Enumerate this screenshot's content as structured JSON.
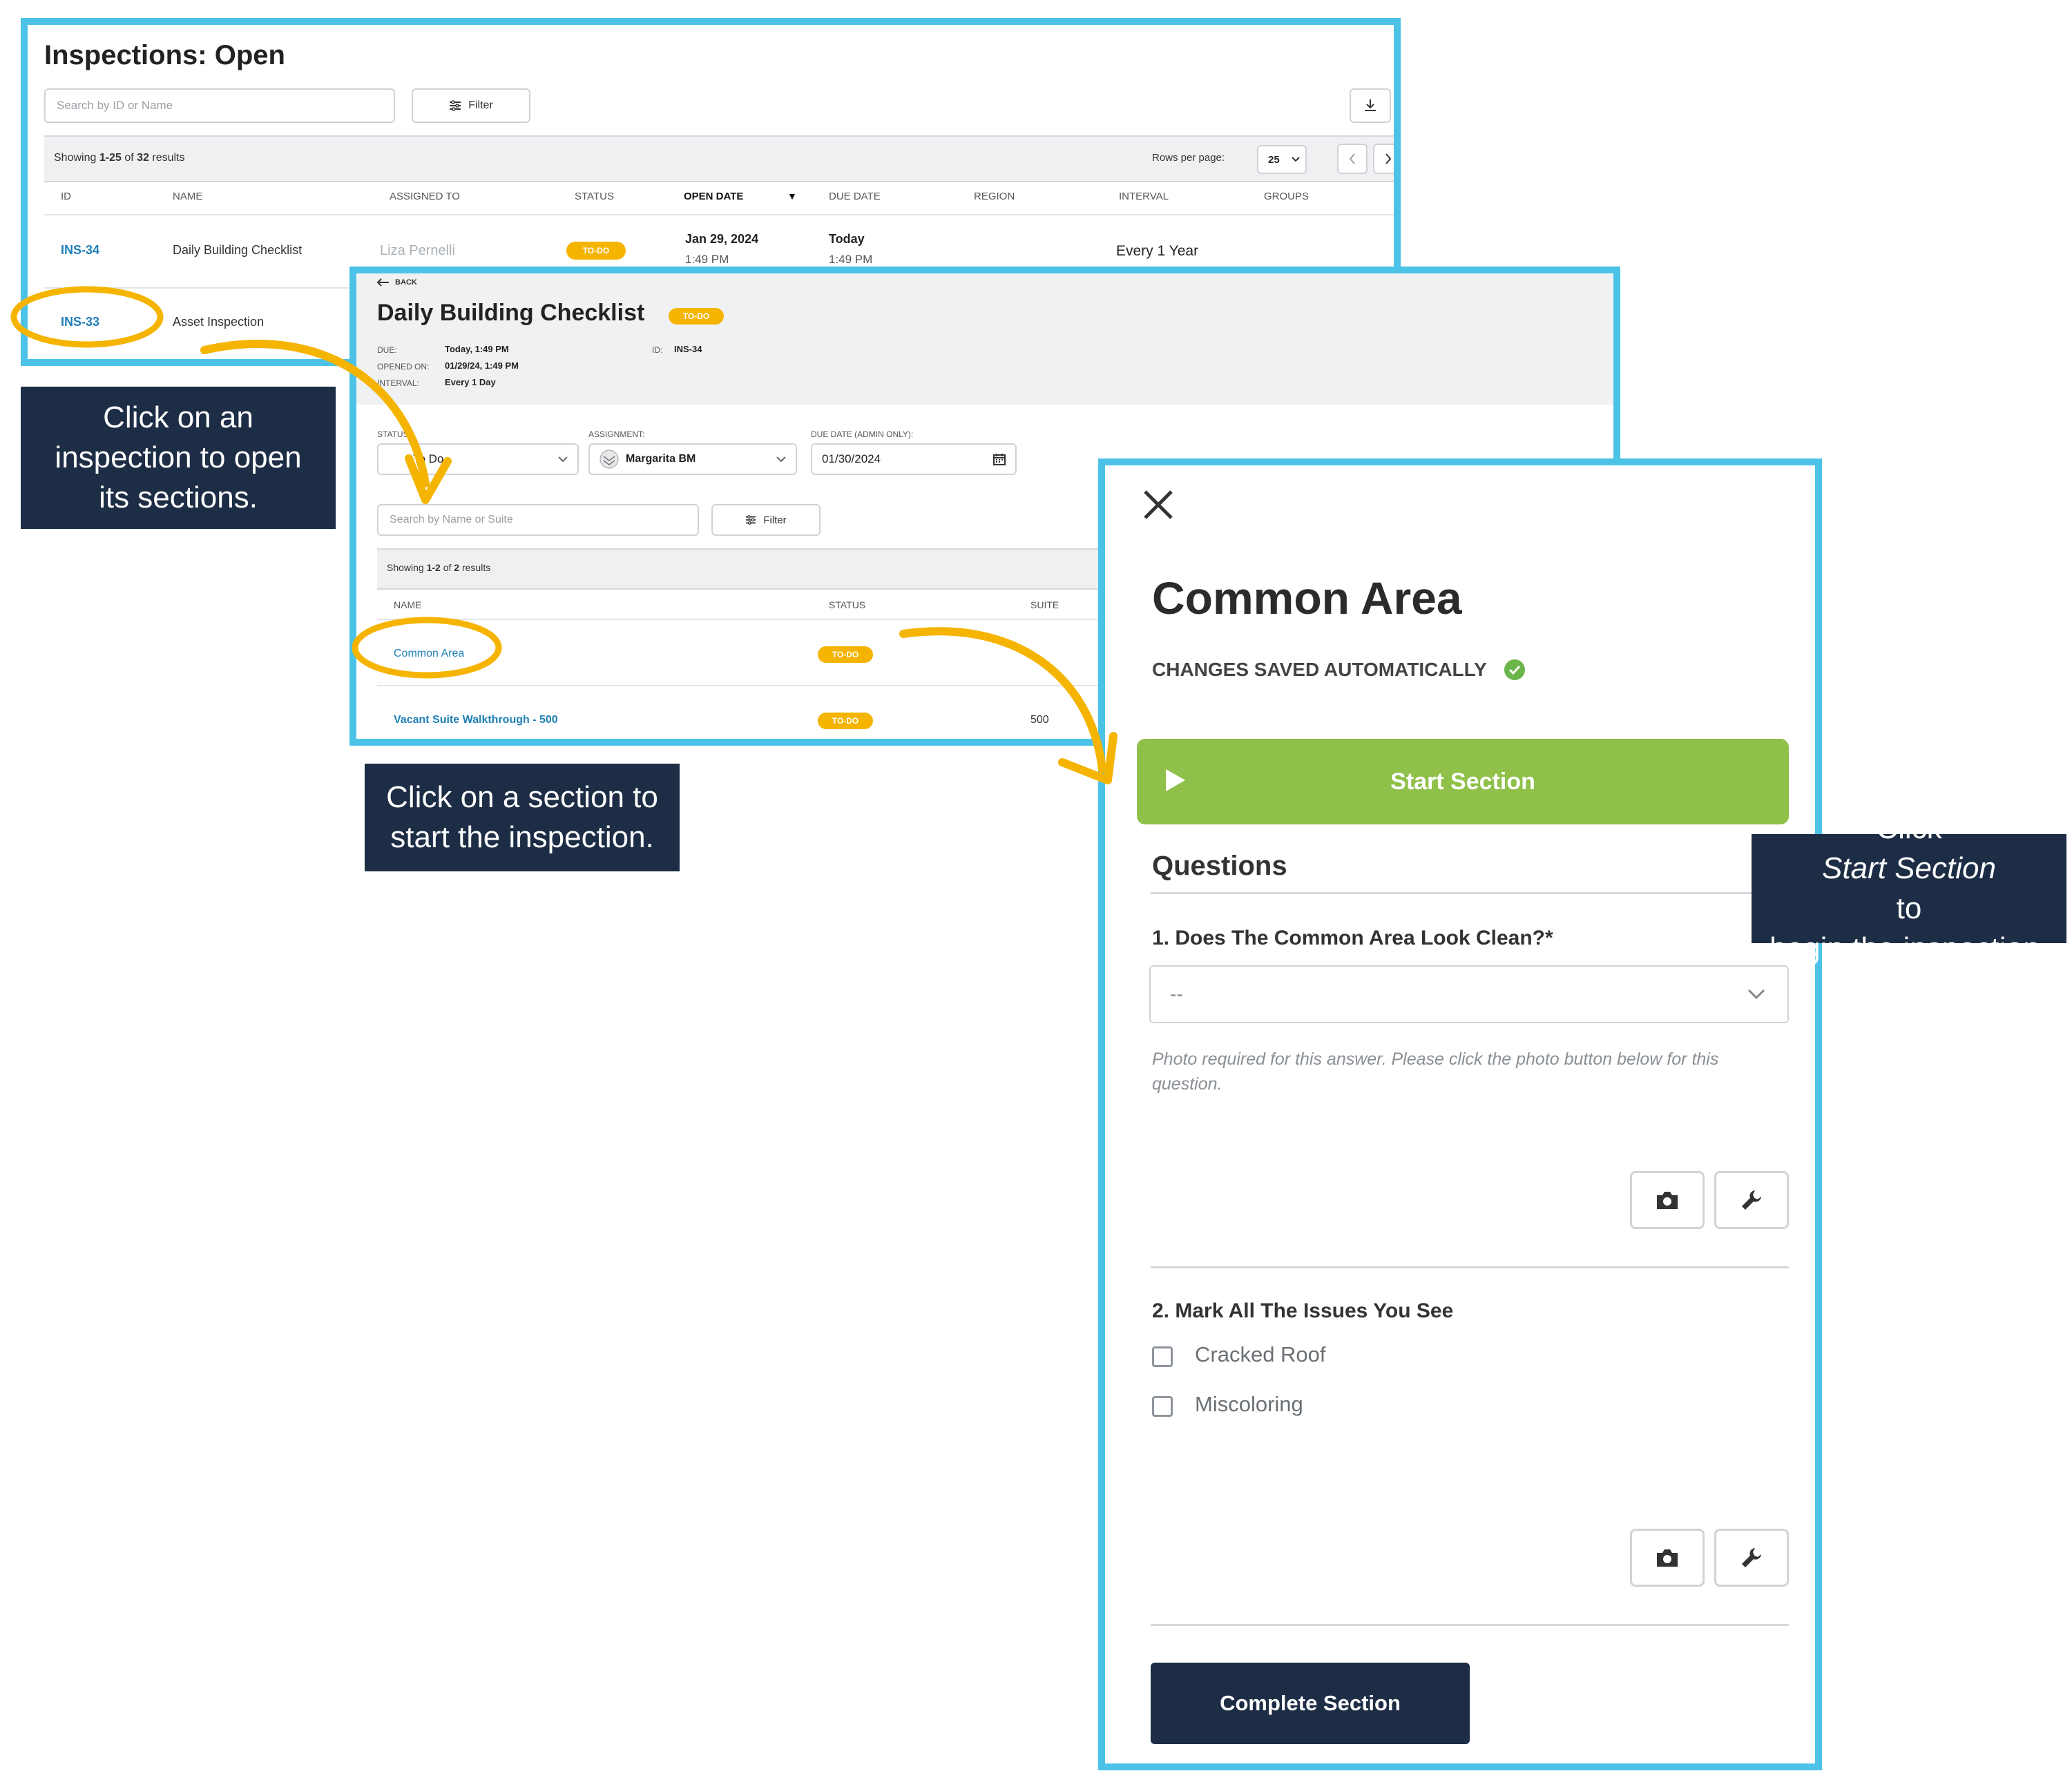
{
  "inspections_list": {
    "title": "Inspections: Open",
    "search_placeholder": "Search by ID or Name",
    "filter_label": "Filter",
    "showing_prefix": "Showing",
    "showing_range": "1-25",
    "showing_of": "of",
    "showing_total": "32",
    "showing_suffix": "results",
    "rows_per_page_label": "Rows per page:",
    "rows_per_page_value": "25",
    "columns": [
      "ID",
      "NAME",
      "ASSIGNED TO",
      "STATUS",
      "OPEN DATE",
      "DUE DATE",
      "REGION",
      "INTERVAL",
      "GROUPS"
    ],
    "rows": [
      {
        "id": "INS-34",
        "name": "Daily Building Checklist",
        "assigned_to": "Liza Pernelli",
        "status": "TO-DO",
        "open_date": "Jan 29, 2024",
        "open_time": "1:49 PM",
        "due_date": "Today",
        "due_time": "1:49 PM",
        "interval": "Every 1 Year"
      },
      {
        "id": "INS-33",
        "name": "Asset Inspection"
      }
    ]
  },
  "inspection_detail": {
    "back_label": "BACK",
    "title": "Daily Building Checklist",
    "status_badge": "TO-DO",
    "due_label": "DUE:",
    "due_value": "Today, 1:49 PM",
    "opened_label": "OPENED ON:",
    "opened_value": "01/29/24, 1:49 PM",
    "interval_label": "INTERVAL:",
    "interval_value": "Every 1 Day",
    "id_label": "ID:",
    "id_value": "INS-34",
    "status_label": "STATUS:",
    "status_value": "To Do",
    "assignment_label": "ASSIGNMENT:",
    "assignment_value": "Margarita BM",
    "due_date_label": "DUE DATE (ADMIN ONLY):",
    "due_date_value": "01/30/2024",
    "search_placeholder": "Search by Name or Suite",
    "filter_label": "Filter",
    "showing_prefix": "Showing",
    "showing_range": "1-2",
    "showing_of": "of",
    "showing_total": "2",
    "showing_suffix": "results",
    "columns": [
      "NAME",
      "STATUS",
      "SUITE"
    ],
    "sections": [
      {
        "name": "Common Area",
        "status": "TO-DO",
        "suite": ""
      },
      {
        "name": "Vacant Suite Walkthrough - 500",
        "status": "TO-DO",
        "suite": "500"
      }
    ]
  },
  "section_detail": {
    "title": "Common Area",
    "autosave_text": "CHANGES SAVED AUTOMATICALLY",
    "start_button": "Start Section",
    "questions_heading": "Questions",
    "q1_title": "1. Does The Common Area Look Clean?*",
    "q1_select_value": "--",
    "q1_note": "Photo required for this answer. Please click the photo button below for this question.",
    "q2_title": "2. Mark All The Issues You See",
    "q2_options": [
      "Cracked Roof",
      "Miscoloring"
    ],
    "complete_button": "Complete Section"
  },
  "callouts": {
    "c1": [
      "Click on an",
      "inspection to open",
      "its sections."
    ],
    "c2": [
      "Click on a section to",
      "start the inspection."
    ],
    "c3_prefix": "Click ",
    "c3_italic": "Start Section",
    "c3_suffix": " to",
    "c3_line2": "begin the inspection."
  },
  "colors": {
    "frame": "#4cc3e6",
    "highlight": "#f5b400",
    "callout_bg": "#1d2d45",
    "start_green": "#8fc04a",
    "link_blue": "#1f7fb6"
  },
  "icons": [
    "filter-icon",
    "download-icon",
    "chevron-left-icon",
    "chevron-right-icon",
    "back-arrow-icon",
    "calendar-icon",
    "chevron-down-icon",
    "close-icon",
    "check-circle-icon",
    "play-icon",
    "camera-icon",
    "wrench-icon"
  ]
}
